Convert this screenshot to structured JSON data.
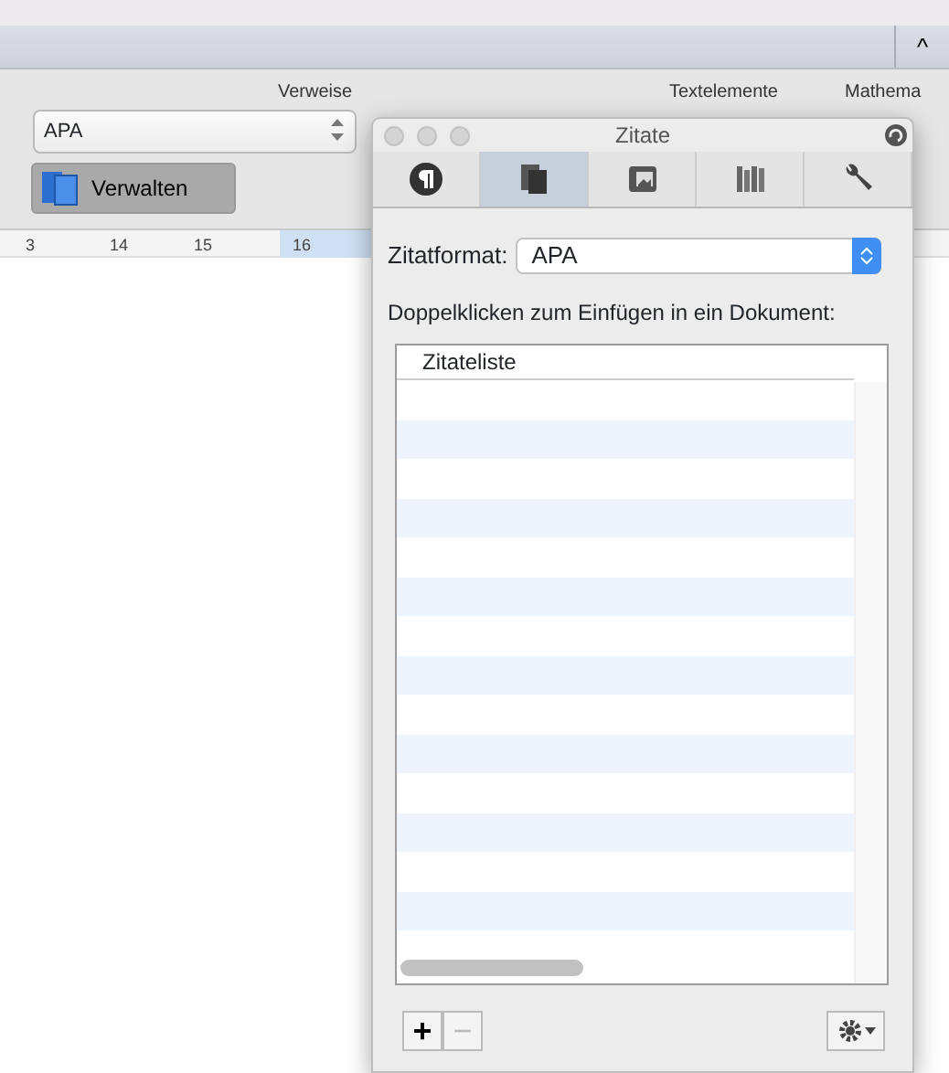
{
  "ribbon": {
    "collapse": "^",
    "groups": [
      {
        "title": "Verweise"
      },
      {
        "title": "Textelemente"
      },
      {
        "title": "Mathema"
      }
    ],
    "style_select": {
      "value": "APA"
    },
    "manage_button": {
      "label": "Verwalten"
    }
  },
  "ruler": {
    "numbers": [
      "3",
      "14",
      "15",
      "16"
    ]
  },
  "panel": {
    "title": "Zitate",
    "tabs": [
      {
        "kind": "paragraph",
        "selected": false
      },
      {
        "kind": "copies",
        "selected": true
      },
      {
        "kind": "notebook",
        "selected": false
      },
      {
        "kind": "books",
        "selected": false
      },
      {
        "kind": "wrench",
        "selected": false
      }
    ],
    "format_label": "Zitatformat:",
    "format_value": "APA",
    "hint": "Doppelklicken zum Einfügen in ein Dokument:",
    "list": {
      "column": "Zitateliste"
    },
    "buttons": [
      {
        "label": "+",
        "disabled": false
      },
      {
        "label": "−",
        "disabled": true
      }
    ]
  }
}
